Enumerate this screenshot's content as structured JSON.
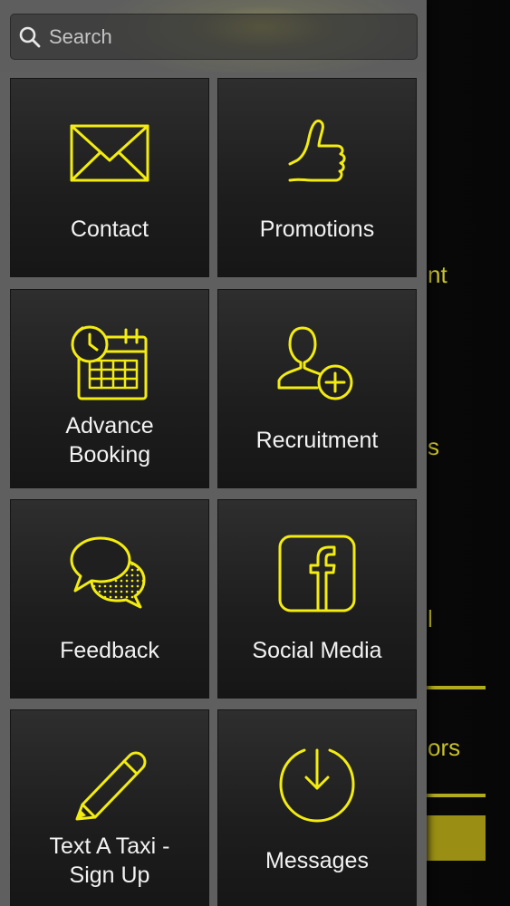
{
  "search": {
    "placeholder": "Search"
  },
  "tiles": [
    {
      "label": "Contact",
      "icon": "envelope-icon"
    },
    {
      "label": "Promotions",
      "icon": "thumbs-up-icon"
    },
    {
      "label_line1": "Advance",
      "label_line2": "Booking",
      "icon": "clock-calendar-icon"
    },
    {
      "label": "Recruitment",
      "icon": "add-user-icon"
    },
    {
      "label": "Feedback",
      "icon": "chat-bubbles-icon"
    },
    {
      "label": "Social Media",
      "icon": "facebook-icon"
    },
    {
      "label_line1": "Text A Taxi -",
      "label_line2": "Sign Up",
      "icon": "pencil-icon"
    },
    {
      "label": "Messages",
      "icon": "download-circle-icon"
    }
  ],
  "background_fragments": [
    "nt",
    "s",
    "l",
    "ors"
  ],
  "colors": {
    "accent": "#f3ec11",
    "drawer": "#5f5f5f",
    "tile": "#1d1d1d",
    "background_text": "#c9c22a"
  }
}
